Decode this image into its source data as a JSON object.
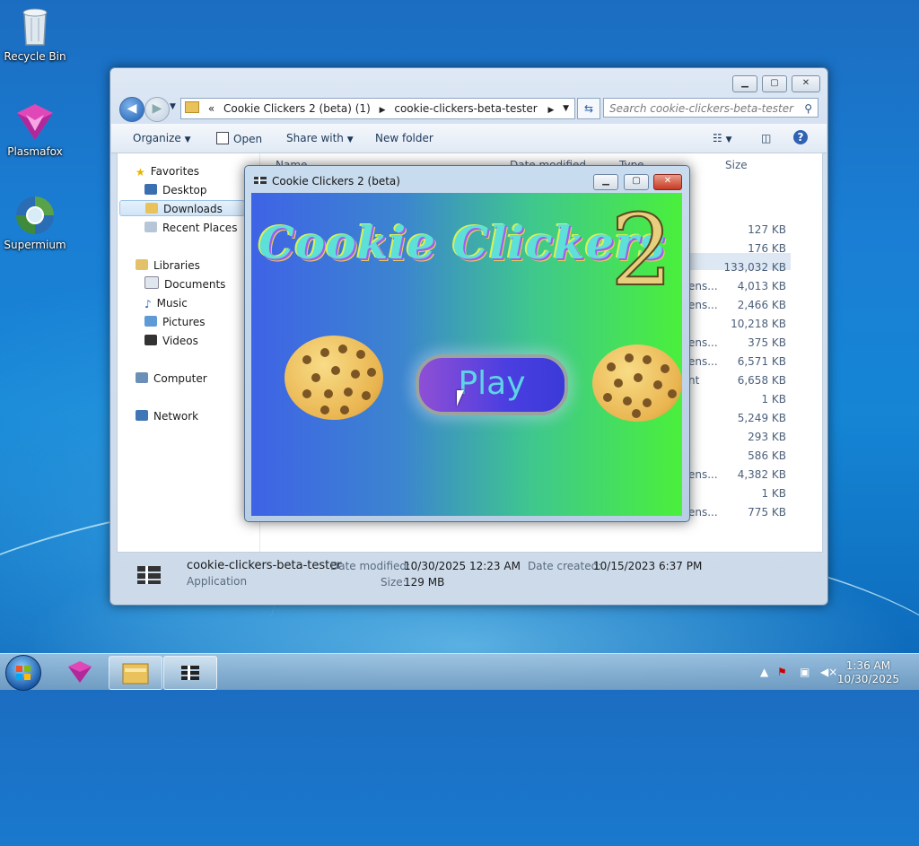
{
  "desktop": {
    "icons": [
      {
        "label": "Recycle Bin",
        "icon": "recycle-bin-icon"
      },
      {
        "label": "Plasmafox",
        "icon": "plasmafox-icon"
      },
      {
        "label": "Supermium",
        "icon": "supermium-icon"
      }
    ]
  },
  "explorer": {
    "breadcrumb": [
      "Cookie Clickers 2 (beta) (1)",
      "cookie-clickers-beta-tester"
    ],
    "search_placeholder": "Search cookie-clickers-beta-tester",
    "toolbar": {
      "organize": "Organize",
      "open": "Open",
      "share": "Share with",
      "new_folder": "New folder"
    },
    "nav": {
      "favorites": "Favorites",
      "desktop": "Desktop",
      "downloads": "Downloads",
      "recent": "Recent Places",
      "libraries": "Libraries",
      "documents": "Documents",
      "music": "Music",
      "pictures": "Pictures",
      "videos": "Videos",
      "computer": "Computer",
      "network": "Network"
    },
    "columns": {
      "name": "Name",
      "date": "Date modified",
      "type": "Type",
      "size": "Size"
    },
    "sizes": [
      "127 KB",
      "176 KB",
      "133,032 KB",
      "4,013 KB",
      "2,466 KB",
      "10,218 KB",
      "375 KB",
      "6,571 KB",
      "6,658 KB",
      "1 KB",
      "5,249 KB",
      "293 KB",
      "586 KB",
      "4,382 KB",
      "1 KB",
      "775 KB"
    ],
    "type_fragments": [
      "ens...",
      "ens...",
      "ens...",
      "ens...",
      "nt",
      "ens...",
      "ens..."
    ],
    "details": {
      "name": "cookie-clickers-beta-tester",
      "kind": "Application",
      "date_modified_label": "Date modified:",
      "date_modified": "10/30/2025 12:23 AM",
      "size_label": "Size:",
      "size": "129 MB",
      "date_created_label": "Date created:",
      "date_created": "10/15/2023 6:37 PM"
    }
  },
  "game": {
    "window_title": "Cookie Clickers 2 (beta)",
    "title_text": "Cookie Clickers",
    "title_number": "2",
    "play_label": "Play"
  },
  "taskbar": {
    "time": "1:36 AM",
    "date": "10/30/2025"
  }
}
